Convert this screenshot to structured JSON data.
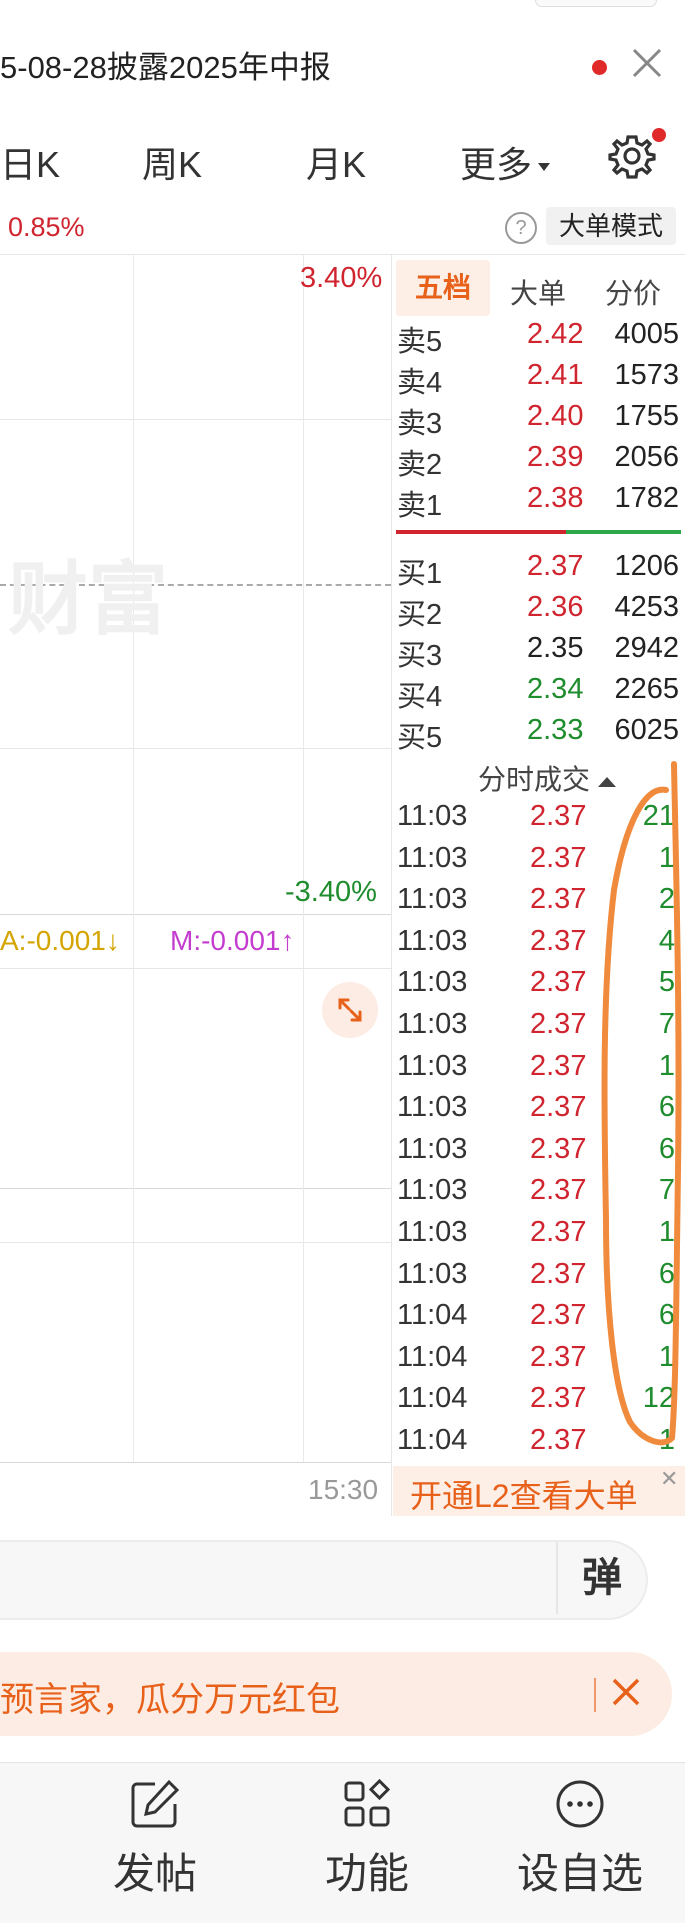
{
  "header": {
    "notice_title": "5-08-28披露2025年中报"
  },
  "tabs": {
    "items": [
      "日K",
      "周K",
      "月K",
      "更多"
    ]
  },
  "info": {
    "change_pct": "0.85%",
    "help_label": "?",
    "big_order_mode": "大单模式"
  },
  "chart": {
    "pct_high": "3.40%",
    "pct_low": "-3.40%",
    "watermark": "财富",
    "indicator_a": "A:-0.001↓",
    "indicator_m": "M:-0.001↑",
    "time_end": "15:30"
  },
  "order_book": {
    "tabs": [
      "五档",
      "大单",
      "分价"
    ],
    "sell": [
      {
        "label": "卖5",
        "price": "2.42",
        "volume": "4005",
        "color": "#d0242f"
      },
      {
        "label": "卖4",
        "price": "2.41",
        "volume": "1573",
        "color": "#d0242f"
      },
      {
        "label": "卖3",
        "price": "2.40",
        "volume": "1755",
        "color": "#d0242f"
      },
      {
        "label": "卖2",
        "price": "2.39",
        "volume": "2056",
        "color": "#d0242f"
      },
      {
        "label": "卖1",
        "price": "2.38",
        "volume": "1782",
        "color": "#d0242f"
      }
    ],
    "buy": [
      {
        "label": "买1",
        "price": "2.37",
        "volume": "1206",
        "color": "#d0242f"
      },
      {
        "label": "买2",
        "price": "2.36",
        "volume": "4253",
        "color": "#d0242f"
      },
      {
        "label": "买3",
        "price": "2.35",
        "volume": "2942",
        "color": "#222222"
      },
      {
        "label": "买4",
        "price": "2.34",
        "volume": "2265",
        "color": "#1f8c2e"
      },
      {
        "label": "买5",
        "price": "2.33",
        "volume": "6025",
        "color": "#1f8c2e"
      }
    ]
  },
  "trades": {
    "title": "分时成交",
    "rows": [
      {
        "time": "11:03",
        "price": "2.37",
        "vol": "21"
      },
      {
        "time": "11:03",
        "price": "2.37",
        "vol": "1"
      },
      {
        "time": "11:03",
        "price": "2.37",
        "vol": "2"
      },
      {
        "time": "11:03",
        "price": "2.37",
        "vol": "4"
      },
      {
        "time": "11:03",
        "price": "2.37",
        "vol": "5"
      },
      {
        "time": "11:03",
        "price": "2.37",
        "vol": "7"
      },
      {
        "time": "11:03",
        "price": "2.37",
        "vol": "1"
      },
      {
        "time": "11:03",
        "price": "2.37",
        "vol": "6"
      },
      {
        "time": "11:03",
        "price": "2.37",
        "vol": "6"
      },
      {
        "time": "11:03",
        "price": "2.37",
        "vol": "7"
      },
      {
        "time": "11:03",
        "price": "2.37",
        "vol": "1"
      },
      {
        "time": "11:03",
        "price": "2.37",
        "vol": "6"
      },
      {
        "time": "11:04",
        "price": "2.37",
        "vol": "6"
      },
      {
        "time": "11:04",
        "price": "2.37",
        "vol": "1"
      },
      {
        "time": "11:04",
        "price": "2.37",
        "vol": "12"
      },
      {
        "time": "11:04",
        "price": "2.37",
        "vol": "1"
      }
    ],
    "l2_banner": "开通L2查看大单"
  },
  "comment": {
    "danmu_label": "弹"
  },
  "promo": {
    "text": "预言家，瓜分万元红包"
  },
  "bottom_nav": [
    {
      "label": "发帖",
      "icon": "edit-icon"
    },
    {
      "label": "功能",
      "icon": "grid-icon"
    },
    {
      "label": "设自选",
      "icon": "more-dots-icon"
    }
  ],
  "colors": {
    "up": "#d0242f",
    "down": "#1f8c2e",
    "accent": "#e8611a",
    "annotation": "#f08a3c"
  }
}
